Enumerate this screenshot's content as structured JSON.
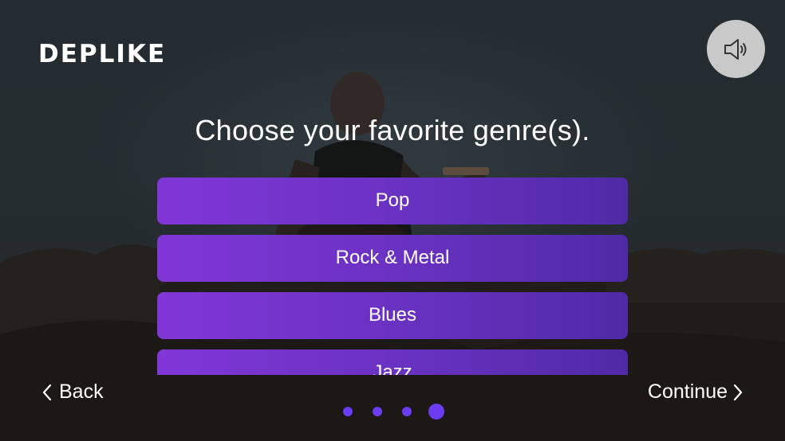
{
  "brand": {
    "logo_text": "DEPLIKE"
  },
  "sound": {
    "icon": "speaker-icon"
  },
  "title": "Choose your favorite genre(s).",
  "genres": [
    {
      "label": "Pop"
    },
    {
      "label": "Rock & Metal"
    },
    {
      "label": "Blues"
    },
    {
      "label": "Jazz"
    }
  ],
  "navigation": {
    "back_label": "Back",
    "continue_label": "Continue",
    "back_icon": "chevron-left-icon",
    "continue_icon": "chevron-right-icon"
  },
  "pager": {
    "total": 4,
    "current": 4
  },
  "colors": {
    "accent": "#6b3cf0",
    "button_gradient_start": "#8136d8",
    "button_gradient_end": "#4f2aa6",
    "sound_button_bg": "#c9c9c9"
  }
}
